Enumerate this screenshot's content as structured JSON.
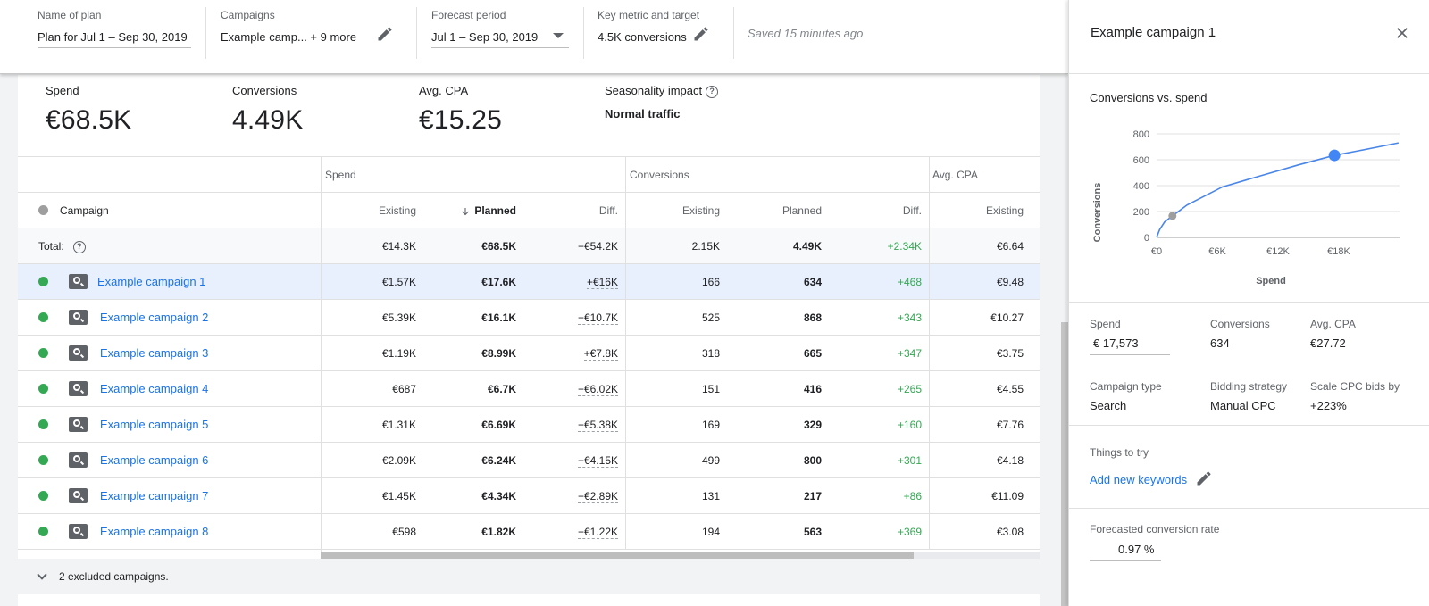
{
  "header": {
    "plan_label": "Name of plan",
    "plan_value": "Plan for Jul 1 – Sep 30, 2019",
    "campaigns_label": "Campaigns",
    "campaigns_value": "Example camp... + 9 more",
    "forecast_label": "Forecast period",
    "forecast_value": "Jul 1 – Sep 30, 2019",
    "metric_label": "Key metric and target",
    "metric_value": "4.5K conversions",
    "saved_status": "Saved 15 minutes ago"
  },
  "summary": {
    "spend_label": "Spend",
    "spend_value": "€68.5K",
    "conversions_label": "Conversions",
    "conversions_value": "4.49K",
    "cpa_label": "Avg. CPA",
    "cpa_value": "€15.25",
    "seasonality_label": "Seasonality impact",
    "seasonality_value": "Normal traffic"
  },
  "table": {
    "groups": {
      "spend": "Spend",
      "conversions": "Conversions",
      "cpa": "Avg. CPA"
    },
    "columns": {
      "campaign": "Campaign",
      "spend_existing": "Existing",
      "spend_planned": "Planned",
      "spend_diff": "Diff.",
      "conv_existing": "Existing",
      "conv_planned": "Planned",
      "conv_diff": "Diff.",
      "cpa_existing": "Existing"
    },
    "total": {
      "label": "Total:",
      "spend_existing": "€14.3K",
      "spend_planned": "€68.5K",
      "spend_diff": "+€54.2K",
      "conv_existing": "2.15K",
      "conv_planned": "4.49K",
      "conv_diff": "+2.34K",
      "cpa_existing": "€6.64"
    },
    "rows": [
      {
        "name": "Example campaign 1",
        "spend_existing": "€1.57K",
        "spend_planned": "€17.6K",
        "spend_diff": "+€16K",
        "conv_existing": "166",
        "conv_planned": "634",
        "conv_diff": "+468",
        "cpa_existing": "€9.48"
      },
      {
        "name": "Example campaign 2",
        "spend_existing": "€5.39K",
        "spend_planned": "€16.1K",
        "spend_diff": "+€10.7K",
        "conv_existing": "525",
        "conv_planned": "868",
        "conv_diff": "+343",
        "cpa_existing": "€10.27"
      },
      {
        "name": "Example campaign 3",
        "spend_existing": "€1.19K",
        "spend_planned": "€8.99K",
        "spend_diff": "+€7.8K",
        "conv_existing": "318",
        "conv_planned": "665",
        "conv_diff": "+347",
        "cpa_existing": "€3.75"
      },
      {
        "name": "Example campaign 4",
        "spend_existing": "€687",
        "spend_planned": "€6.7K",
        "spend_diff": "+€6.02K",
        "conv_existing": "151",
        "conv_planned": "416",
        "conv_diff": "+265",
        "cpa_existing": "€4.55"
      },
      {
        "name": "Example campaign 5",
        "spend_existing": "€1.31K",
        "spend_planned": "€6.69K",
        "spend_diff": "+€5.38K",
        "conv_existing": "169",
        "conv_planned": "329",
        "conv_diff": "+160",
        "cpa_existing": "€7.76"
      },
      {
        "name": "Example campaign 6",
        "spend_existing": "€2.09K",
        "spend_planned": "€6.24K",
        "spend_diff": "+€4.15K",
        "conv_existing": "499",
        "conv_planned": "800",
        "conv_diff": "+301",
        "cpa_existing": "€4.18"
      },
      {
        "name": "Example campaign 7",
        "spend_existing": "€1.45K",
        "spend_planned": "€4.34K",
        "spend_diff": "+€2.89K",
        "conv_existing": "131",
        "conv_planned": "217",
        "conv_diff": "+86",
        "cpa_existing": "€11.09"
      },
      {
        "name": "Example campaign 8",
        "spend_existing": "€598",
        "spend_planned": "€1.82K",
        "spend_diff": "+€1.22K",
        "conv_existing": "194",
        "conv_planned": "563",
        "conv_diff": "+369",
        "cpa_existing": "€3.08"
      }
    ],
    "excluded_label": "2 excluded campaigns."
  },
  "panel": {
    "title": "Example campaign 1",
    "chart_title": "Conversions vs. spend",
    "spend_label": "Spend",
    "spend_value": "€ 17,573",
    "conversions_label": "Conversions",
    "conversions_value": "634",
    "cpa_label": "Avg. CPA",
    "cpa_value": "€27.72",
    "campaign_type_label": "Campaign type",
    "campaign_type_value": "Search",
    "bidding_label": "Bidding strategy",
    "bidding_value": "Manual CPC",
    "scale_label": "Scale CPC bids by",
    "scale_value": "+223%",
    "things_label": "Things to try",
    "things_link": "Add new keywords",
    "rate_label": "Forecasted conversion rate",
    "rate_value": "0.97 %"
  },
  "chart_data": {
    "type": "line",
    "title": "Conversions vs. spend",
    "xlabel": "Spend",
    "ylabel": "Conversions",
    "x_ticks": [
      "€0",
      "€6K",
      "€12K",
      "€18K"
    ],
    "y_ticks": [
      "0",
      "200",
      "400",
      "600",
      "800"
    ],
    "xlim": [
      0,
      24000
    ],
    "ylim": [
      0,
      800
    ],
    "series": [
      {
        "x": [
          0,
          300,
          800,
          1570,
          3000,
          6500,
          10000,
          14000,
          17573,
          20000,
          23900
        ],
        "y": [
          0,
          60,
          120,
          166,
          250,
          390,
          470,
          560,
          634,
          670,
          730
        ]
      }
    ],
    "markers": [
      {
        "label": "existing",
        "x": 1570,
        "y": 166,
        "color": "#9e9e9e"
      },
      {
        "label": "planned",
        "x": 17573,
        "y": 634,
        "color": "#4285f4"
      }
    ],
    "line_color": "#4a86e8",
    "grid": true
  },
  "colors": {
    "accent": "#1a73e8",
    "positive": "#34a853",
    "selected_row": "#e8f0fe"
  }
}
